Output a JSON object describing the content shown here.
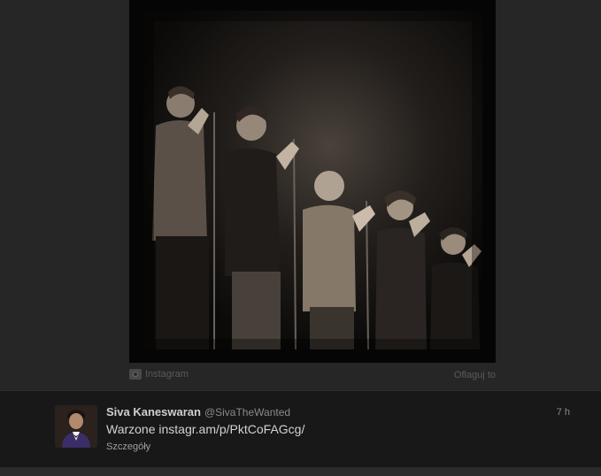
{
  "media": {
    "source_label": "Instagram",
    "flag_label": "Oflaguj to"
  },
  "tweet": {
    "name": "Siva Kaneswaran",
    "handle": "@SivaTheWanted",
    "timestamp": "7 h",
    "text": "Warzone instagr.am/p/PktCoFAGcg/",
    "details_label": "Szczegóły"
  },
  "colors": {
    "background": "#242424",
    "tweet_background": "#181818",
    "name_text": "#cfcfcf",
    "muted_text": "#8a8a8a"
  },
  "icons": {
    "source": "camera-icon"
  }
}
